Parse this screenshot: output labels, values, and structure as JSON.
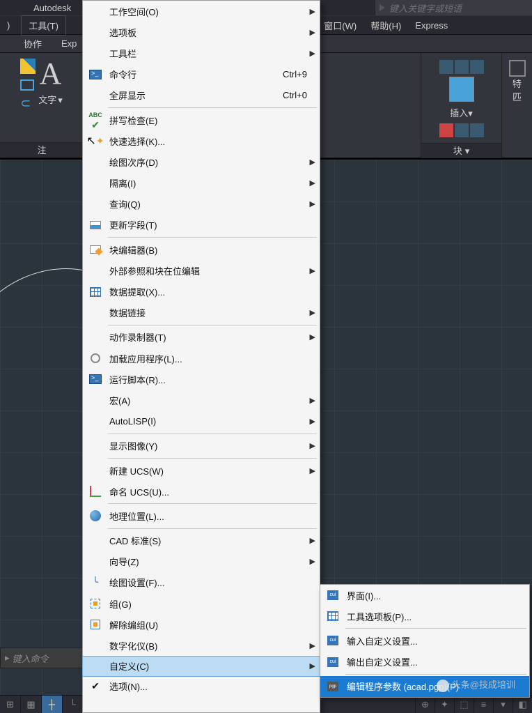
{
  "title": "Autodesk",
  "search": {
    "placeholder": "键入关键字或短语"
  },
  "menubar": {
    "item0": ")",
    "tools": "工具(T)",
    "window": "窗口(W)",
    "help": "帮助(H)",
    "express": "Express"
  },
  "tabs": {
    "collab": "协作",
    "exp": "Exp"
  },
  "ribbon": {
    "text_label": "文字",
    "annotation_panel": "注",
    "insert_label": "插入",
    "block_panel": "块",
    "props_label": "特",
    "props_sub": "匹"
  },
  "cmd": {
    "placeholder": "键入命令"
  },
  "menu": {
    "workspace": "工作空间(O)",
    "palette": "选项板",
    "toolbar": "工具栏",
    "cmdline": "命令行",
    "cmdline_sc": "Ctrl+9",
    "fullscreen": "全屏显示",
    "fullscreen_sc": "Ctrl+0",
    "spellcheck": "拼写检查(E)",
    "quickselect": "快速选择(K)...",
    "draworder": "绘图次序(D)",
    "isolate": "隔离(I)",
    "inquiry": "查询(Q)",
    "updatefield": "更新字段(T)",
    "blockedit": "块编辑器(B)",
    "xrefedit": "外部参照和块在位编辑",
    "dataextract": "数据提取(X)...",
    "datalink": "数据链接",
    "actionrec": "动作录制器(T)",
    "loadapp": "加载应用程序(L)...",
    "runscript": "运行脚本(R)...",
    "macro": "宏(A)",
    "autolisp": "AutoLISP(I)",
    "showimg": "显示图像(Y)",
    "newucs": "新建 UCS(W)",
    "namedu": "命名 UCS(U)...",
    "geoloc": "地理位置(L)...",
    "standards": "CAD 标准(S)",
    "wizard": "向导(Z)",
    "draftset": "绘图设置(F)...",
    "group": "组(G)",
    "ungroup": "解除编组(U)",
    "tablet": "数字化仪(B)",
    "customize": "自定义(C)",
    "options": "选项(N)..."
  },
  "submenu": {
    "interface": "界面(I)...",
    "toolpalette": "工具选项板(P)...",
    "importcust": "输入自定义设置...",
    "exportcust": "输出自定义设置...",
    "editpgp": "编辑程序参数 (acad.pgp)(P)"
  },
  "watermark": "头条@技成培训"
}
